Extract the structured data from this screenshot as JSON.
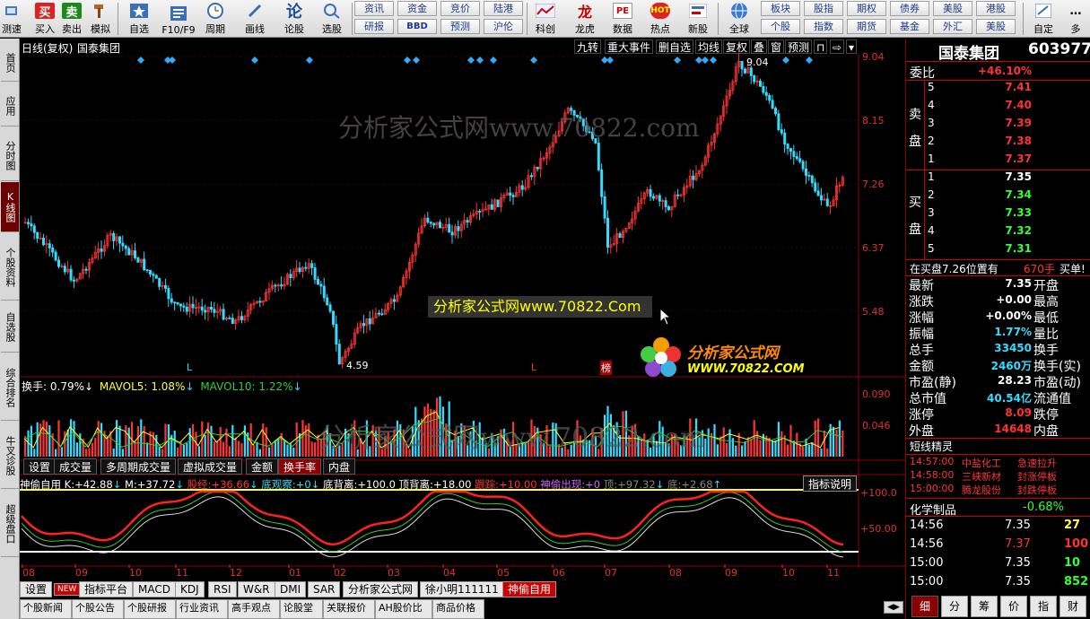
{
  "toolbar": {
    "buttons": [
      {
        "label": "测速",
        "icon": "speed-icon"
      },
      {
        "label": "买入",
        "icon": "buy-icon",
        "glyph": "买"
      },
      {
        "label": "卖出",
        "icon": "sell-icon",
        "glyph": "卖"
      },
      {
        "label": "模拟",
        "icon": "hammer-icon"
      },
      {
        "label": "自选",
        "icon": "star-icon"
      },
      {
        "label": "F10/F9",
        "icon": "document-icon"
      },
      {
        "label": "周期",
        "icon": "clock-icon"
      },
      {
        "label": "画线",
        "icon": "pencil-icon"
      },
      {
        "label": "论股",
        "icon": "discuss-icon"
      },
      {
        "label": "选股",
        "icon": "stock-pick-icon"
      },
      {
        "label": "科创",
        "icon": "kechuang-icon"
      },
      {
        "label": "龙虎",
        "icon": "dragon-icon"
      },
      {
        "label": "数据",
        "icon": "pe-icon"
      },
      {
        "label": "热点",
        "icon": "hot-icon"
      },
      {
        "label": "新股",
        "icon": "newstock-icon"
      },
      {
        "label": "全球",
        "icon": "globe-icon"
      },
      {
        "label": "自定",
        "icon": "custom-icon"
      },
      {
        "label": "多",
        "icon": "more-icon"
      }
    ],
    "grid_buttons": [
      [
        "资讯",
        "资金",
        "竞价",
        "陆港"
      ],
      [
        "研报",
        "BBD",
        "预测",
        "沪伦"
      ],
      [
        "板块",
        "股指",
        "期权",
        "债券",
        "美股",
        "港股"
      ],
      [
        "个股",
        "指数",
        "期货",
        "基金",
        "外汇",
        "美股"
      ]
    ]
  },
  "left_tabs": [
    "首页",
    "应用",
    "分时图",
    "K线图",
    "个股资料",
    "自选股",
    "综合排名",
    "牛叉诊股",
    "超级盘口"
  ],
  "chart": {
    "title": "日线(复权)",
    "stock": "国泰集团",
    "controls": [
      "九转",
      "重大事件",
      "删自选",
      "均线",
      "复权",
      "叠",
      "窗",
      "预测",
      "⊓",
      "⇨",
      "▾"
    ],
    "price_axis": [
      "9.04",
      "8.15",
      "7.26",
      "6.37",
      "5.48"
    ],
    "high_label": "9.04",
    "low_label": "4.59",
    "markers": [
      "L",
      "L",
      "榜"
    ],
    "watermark": "分析家公式网www.70822.com",
    "watermark_center": "分析家公式网www.70822.Com",
    "logo_title": "分析家公式网",
    "logo_url": "WWW.70822.COM",
    "vol": {
      "label": "换手:",
      "value": "0.79%",
      "mavol5_label": "MAVOL5:",
      "mavol5": "1.08%",
      "mavol10_label": "MAVOL10:",
      "mavol10": "1.22%",
      "axis": [
        "0.090",
        "0.046"
      ]
    },
    "vol_tabs": [
      "设置",
      "成交量",
      "多周期成交量",
      "虚拟成交量",
      "金额",
      "换手率",
      "内盘"
    ],
    "ind": {
      "name": "神偷自用",
      "items": [
        {
          "k": "K:",
          "v": "+42.88"
        },
        {
          "k": "M:",
          "v": "+37.72"
        },
        {
          "k": "股经:",
          "v": "+36.66"
        },
        {
          "k": "底观察:",
          "v": "+0"
        },
        {
          "k": "底背离:",
          "v": "+100.0"
        },
        {
          "k": "顶背离:",
          "v": "+18.00"
        },
        {
          "k": "跟踪:",
          "v": "+10.00"
        },
        {
          "k": "神偷出现:",
          "v": "+0"
        },
        {
          "k": "顶:",
          "v": "+97.32"
        },
        {
          "k": "底:",
          "v": "+2.68"
        }
      ],
      "explain": "指标说明",
      "axis": [
        "+100.0",
        "+50.00"
      ]
    },
    "months": [
      "08",
      "09",
      "10",
      "11",
      "12",
      "01",
      "02",
      "03",
      "04",
      "05",
      "06",
      "07",
      "08",
      "09",
      "10",
      "11"
    ],
    "ind_tabs": [
      "设置",
      "NEW",
      "指标平台",
      "MACD",
      "KDJ",
      "RSI",
      "W&R",
      "DMI",
      "SAR",
      "分析家公式网",
      "徐小明111111",
      "神偷自用"
    ],
    "news_tabs": [
      "个股新闻",
      "个股公告",
      "个股研报",
      "行业资讯",
      "高手观点",
      "论股堂",
      "关联报价",
      "AH股价比",
      "商品价格"
    ]
  },
  "quote": {
    "name": "国泰集团",
    "code": "603977",
    "weibi_label": "委比",
    "weibi": "+46.10%",
    "sell_label": "卖盘",
    "buy_label": "买盘",
    "sells": [
      {
        "n": "5",
        "p": "7.41"
      },
      {
        "n": "4",
        "p": "7.40"
      },
      {
        "n": "3",
        "p": "7.39"
      },
      {
        "n": "2",
        "p": "7.38"
      },
      {
        "n": "1",
        "p": "7.37"
      }
    ],
    "buys": [
      {
        "n": "1",
        "p": "7.35"
      },
      {
        "n": "2",
        "p": "7.34"
      },
      {
        "n": "3",
        "p": "7.33"
      },
      {
        "n": "4",
        "p": "7.32"
      },
      {
        "n": "5",
        "p": "7.31"
      }
    ],
    "buy_notice": "在买盘7.26位置有",
    "buy_notice_qty": "670手",
    "buy_notice_tag": "买单!",
    "stats": [
      {
        "l": "最新",
        "v": "7.35",
        "r": "开盘"
      },
      {
        "l": "涨跌",
        "v": "+0.00",
        "r": "最高"
      },
      {
        "l": "涨幅",
        "v": "+0.00%",
        "r": "最低"
      },
      {
        "l": "振幅",
        "v": "1.77%",
        "r": "量比"
      },
      {
        "l": "总手",
        "v": "33450",
        "r": "换手"
      },
      {
        "l": "金额",
        "v": "2460万",
        "r": "换手(实)"
      },
      {
        "l": "市盈(静)",
        "v": "28.23",
        "r": "市盈(动)"
      },
      {
        "l": "总市值",
        "v": "40.54亿",
        "r": "流通值"
      },
      {
        "l": "涨停",
        "v": "8.09",
        "r": "跌停"
      },
      {
        "l": "外盘",
        "v": "14648",
        "r": "内盘"
      }
    ],
    "short_title": "短线精灵",
    "shorts": [
      {
        "t": "14:57:00",
        "n": "中盐化工",
        "e": "急速拉升"
      },
      {
        "t": "14:58:00",
        "n": "三峡新材",
        "e": "封涨停板"
      },
      {
        "t": "15:00:00",
        "n": "腾龙股份",
        "e": "封跌停板"
      }
    ],
    "sector_name": "化学制品",
    "sector_pct": "-0.68%",
    "ticks": [
      {
        "t": "14:56",
        "p": "7.35",
        "v": "27"
      },
      {
        "t": "14:56",
        "p": "7.37",
        "v": "100"
      },
      {
        "t": "15:00",
        "p": "7.35",
        "v": "10"
      },
      {
        "t": "15:00",
        "p": "7.35",
        "v": "852"
      }
    ],
    "bottom_tabs": [
      "细",
      "分",
      "筹",
      "价",
      "指",
      "财"
    ]
  },
  "colors": {
    "up": "#ff3333",
    "down": "#33ddff",
    "axis_red": "#e03030",
    "grid_red": "#8b0000"
  }
}
